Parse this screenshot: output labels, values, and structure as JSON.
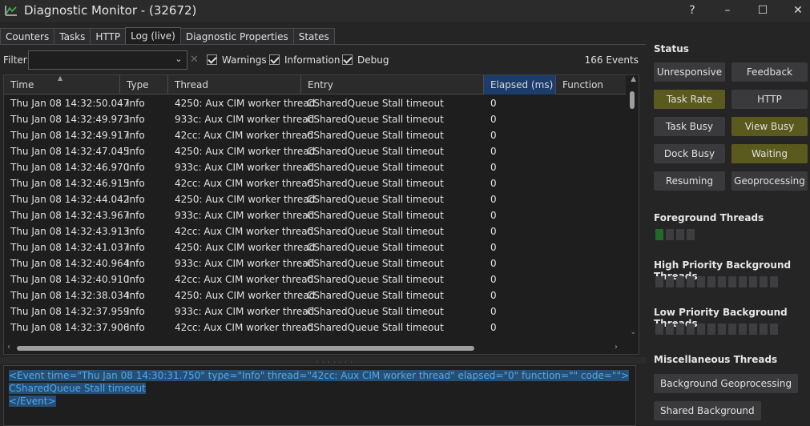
{
  "window": {
    "title": "Diagnostic Monitor - (32672)",
    "help": "?",
    "minimize": "–",
    "maximize": "☐",
    "close": "✕"
  },
  "tabs": [
    "Counters",
    "Tasks",
    "HTTP",
    "Log (live)",
    "Diagnostic Properties",
    "States"
  ],
  "active_tab": "Log (live)",
  "filter": {
    "label": "Filter:",
    "value": "",
    "clear": "✕",
    "warnings_label": "Warnings",
    "information_label": "Information",
    "debug_label": "Debug",
    "warnings_checked": true,
    "information_checked": true,
    "debug_checked": true,
    "event_count": "166 Events"
  },
  "grid": {
    "columns": [
      "Time",
      "Type",
      "Thread",
      "Entry",
      "Elapsed (ms)",
      "Function"
    ],
    "sorted_column": "Elapsed (ms)",
    "rows": [
      [
        "Thu Jan 08 14:32:50.047",
        "Info",
        "4250: Aux CIM worker thread",
        "CSharedQueue Stall timeout",
        "0"
      ],
      [
        "Thu Jan 08 14:32:49.973",
        "Info",
        "933c: Aux CIM worker thread",
        "CSharedQueue Stall timeout",
        "0"
      ],
      [
        "Thu Jan 08 14:32:49.917",
        "Info",
        "42cc: Aux CIM worker thread",
        "CSharedQueue Stall timeout",
        "0"
      ],
      [
        "Thu Jan 08 14:32:47.045",
        "Info",
        "4250: Aux CIM worker thread",
        "CSharedQueue Stall timeout",
        "0"
      ],
      [
        "Thu Jan 08 14:32:46.970",
        "Info",
        "933c: Aux CIM worker thread",
        "CSharedQueue Stall timeout",
        "0"
      ],
      [
        "Thu Jan 08 14:32:46.915",
        "Info",
        "42cc: Aux CIM worker thread",
        "CSharedQueue Stall timeout",
        "0"
      ],
      [
        "Thu Jan 08 14:32:44.042",
        "Info",
        "4250: Aux CIM worker thread",
        "CSharedQueue Stall timeout",
        "0"
      ],
      [
        "Thu Jan 08 14:32:43.967",
        "Info",
        "933c: Aux CIM worker thread",
        "CSharedQueue Stall timeout",
        "0"
      ],
      [
        "Thu Jan 08 14:32:43.913",
        "Info",
        "42cc: Aux CIM worker thread",
        "CSharedQueue Stall timeout",
        "0"
      ],
      [
        "Thu Jan 08 14:32:41.037",
        "Info",
        "4250: Aux CIM worker thread",
        "CSharedQueue Stall timeout",
        "0"
      ],
      [
        "Thu Jan 08 14:32:40.964",
        "Info",
        "933c: Aux CIM worker thread",
        "CSharedQueue Stall timeout",
        "0"
      ],
      [
        "Thu Jan 08 14:32:40.910",
        "Info",
        "42cc: Aux CIM worker thread",
        "CSharedQueue Stall timeout",
        "0"
      ],
      [
        "Thu Jan 08 14:32:38.034",
        "Info",
        "4250: Aux CIM worker thread",
        "CSharedQueue Stall timeout",
        "0"
      ],
      [
        "Thu Jan 08 14:32:37.959",
        "Info",
        "933c: Aux CIM worker thread",
        "CSharedQueue Stall timeout",
        "0"
      ],
      [
        "Thu Jan 08 14:32:37.906",
        "Info",
        "42cc: Aux CIM worker thread",
        "CSharedQueue Stall timeout",
        "0"
      ]
    ]
  },
  "xml_detail": [
    "<Event time=\"Thu Jan 08 14:30:31.750\" type=\"Info\" thread=\"42cc: Aux CIM worker thread\" elapsed=\"0\" function=\"\" code=\"\">",
    "CSharedQueue Stall timeout",
    "</Event>"
  ],
  "status": {
    "title": "Status",
    "buttons": [
      {
        "label": "Unresponsive",
        "active": false
      },
      {
        "label": "Feedback",
        "active": false
      },
      {
        "label": "Task Rate",
        "active": true
      },
      {
        "label": "HTTP",
        "active": false
      },
      {
        "label": "Task Busy",
        "active": false
      },
      {
        "label": "View Busy",
        "active": true
      },
      {
        "label": "Dock Busy",
        "active": false
      },
      {
        "label": "Waiting",
        "active": true
      },
      {
        "label": "Resuming",
        "active": false
      },
      {
        "label": "Geoprocessing",
        "active": false
      }
    ],
    "active_color": "#5a5a1e"
  },
  "foreground_threads": {
    "title": "Foreground Threads",
    "states": [
      "busy",
      "idle",
      "idle",
      "idle"
    ]
  },
  "high_priority_threads": {
    "title": "High Priority Background Threads",
    "count": 12
  },
  "low_priority_threads": {
    "title": "Low Priority Background Threads",
    "count": 12
  },
  "misc_threads": {
    "title": "Miscellaneous Threads",
    "buttons": [
      "Background Geoprocessing",
      "Shared Background"
    ]
  },
  "colors": {
    "busy_thread": "#1f6b2a",
    "idle_thread": "#3e3e40",
    "sorted_header": "#1c3d6b",
    "selection": "#264f78"
  }
}
